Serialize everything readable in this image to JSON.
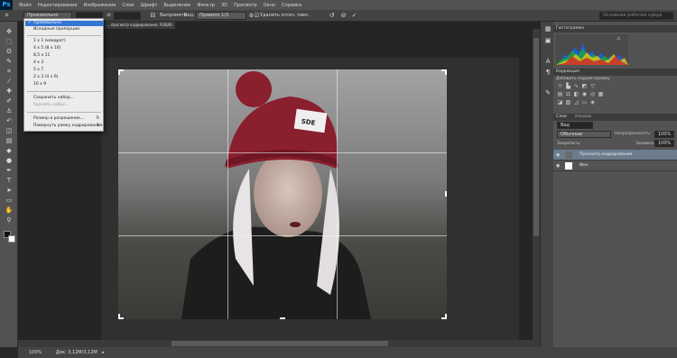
{
  "app": {
    "logo": "Ps"
  },
  "menus": [
    "Файл",
    "Редактирование",
    "Изображение",
    "Слои",
    "Шрифт",
    "Выделение",
    "Фильтр",
    "3D",
    "Просмотр",
    "Окно",
    "Справка"
  ],
  "options": {
    "preset_value": "Произвольно",
    "straighten_label": "Выпрямить",
    "view_label": "Вид:",
    "view_value": "Правило 1/3",
    "delete_pixels_label": "Удалить отсеч. пикс.",
    "workspace_value": "Основная рабочая среда"
  },
  "document": {
    "tab_title": "...просмотр кадрирования, RGB/8)",
    "status_zoom": "100%",
    "status_doc": "Док: 3,12M/3,12M"
  },
  "dropdown": {
    "items": [
      {
        "label": "Произвольно",
        "checked": true
      },
      {
        "label": "Исходные пропорции"
      },
      {
        "label": "1 x 1 (квадрат)"
      },
      {
        "label": "4 x 5 (8 x 10)"
      },
      {
        "label": "8,5 x 11"
      },
      {
        "label": "4 x 3"
      },
      {
        "label": "5 x 7"
      },
      {
        "label": "2 x 3 (4 x 6)"
      },
      {
        "label": "16 x 9"
      },
      {
        "label": "Сохранить набор..."
      },
      {
        "label": "Удалить набор..."
      },
      {
        "label": "Размер и разрешение...",
        "key": "R"
      },
      {
        "label": "Повернуть рамку кадрирования",
        "key": "X"
      }
    ]
  },
  "histogram": {
    "title": "Гистограмма"
  },
  "corrections": {
    "title": "Коррекция",
    "subtitle": "Добавить корректировку"
  },
  "layers": {
    "tab_layers": "Слои",
    "tab_channels": "Каналы",
    "filter_kind": "Вид",
    "blend_mode": "Обычные",
    "opacity_label": "Непрозрачность:",
    "opacity_value": "100%",
    "lock_label": "Закрепить:",
    "fill_label": "Заливка:",
    "fill_value": "100%",
    "items": [
      {
        "name": "Просмотр кадрирования",
        "selected": true
      },
      {
        "name": "Фон"
      }
    ]
  },
  "colors": {
    "accent": "#3177d4",
    "menubar": "#535353",
    "panel": "#535353",
    "photo_hat": "#8a1f2e"
  }
}
